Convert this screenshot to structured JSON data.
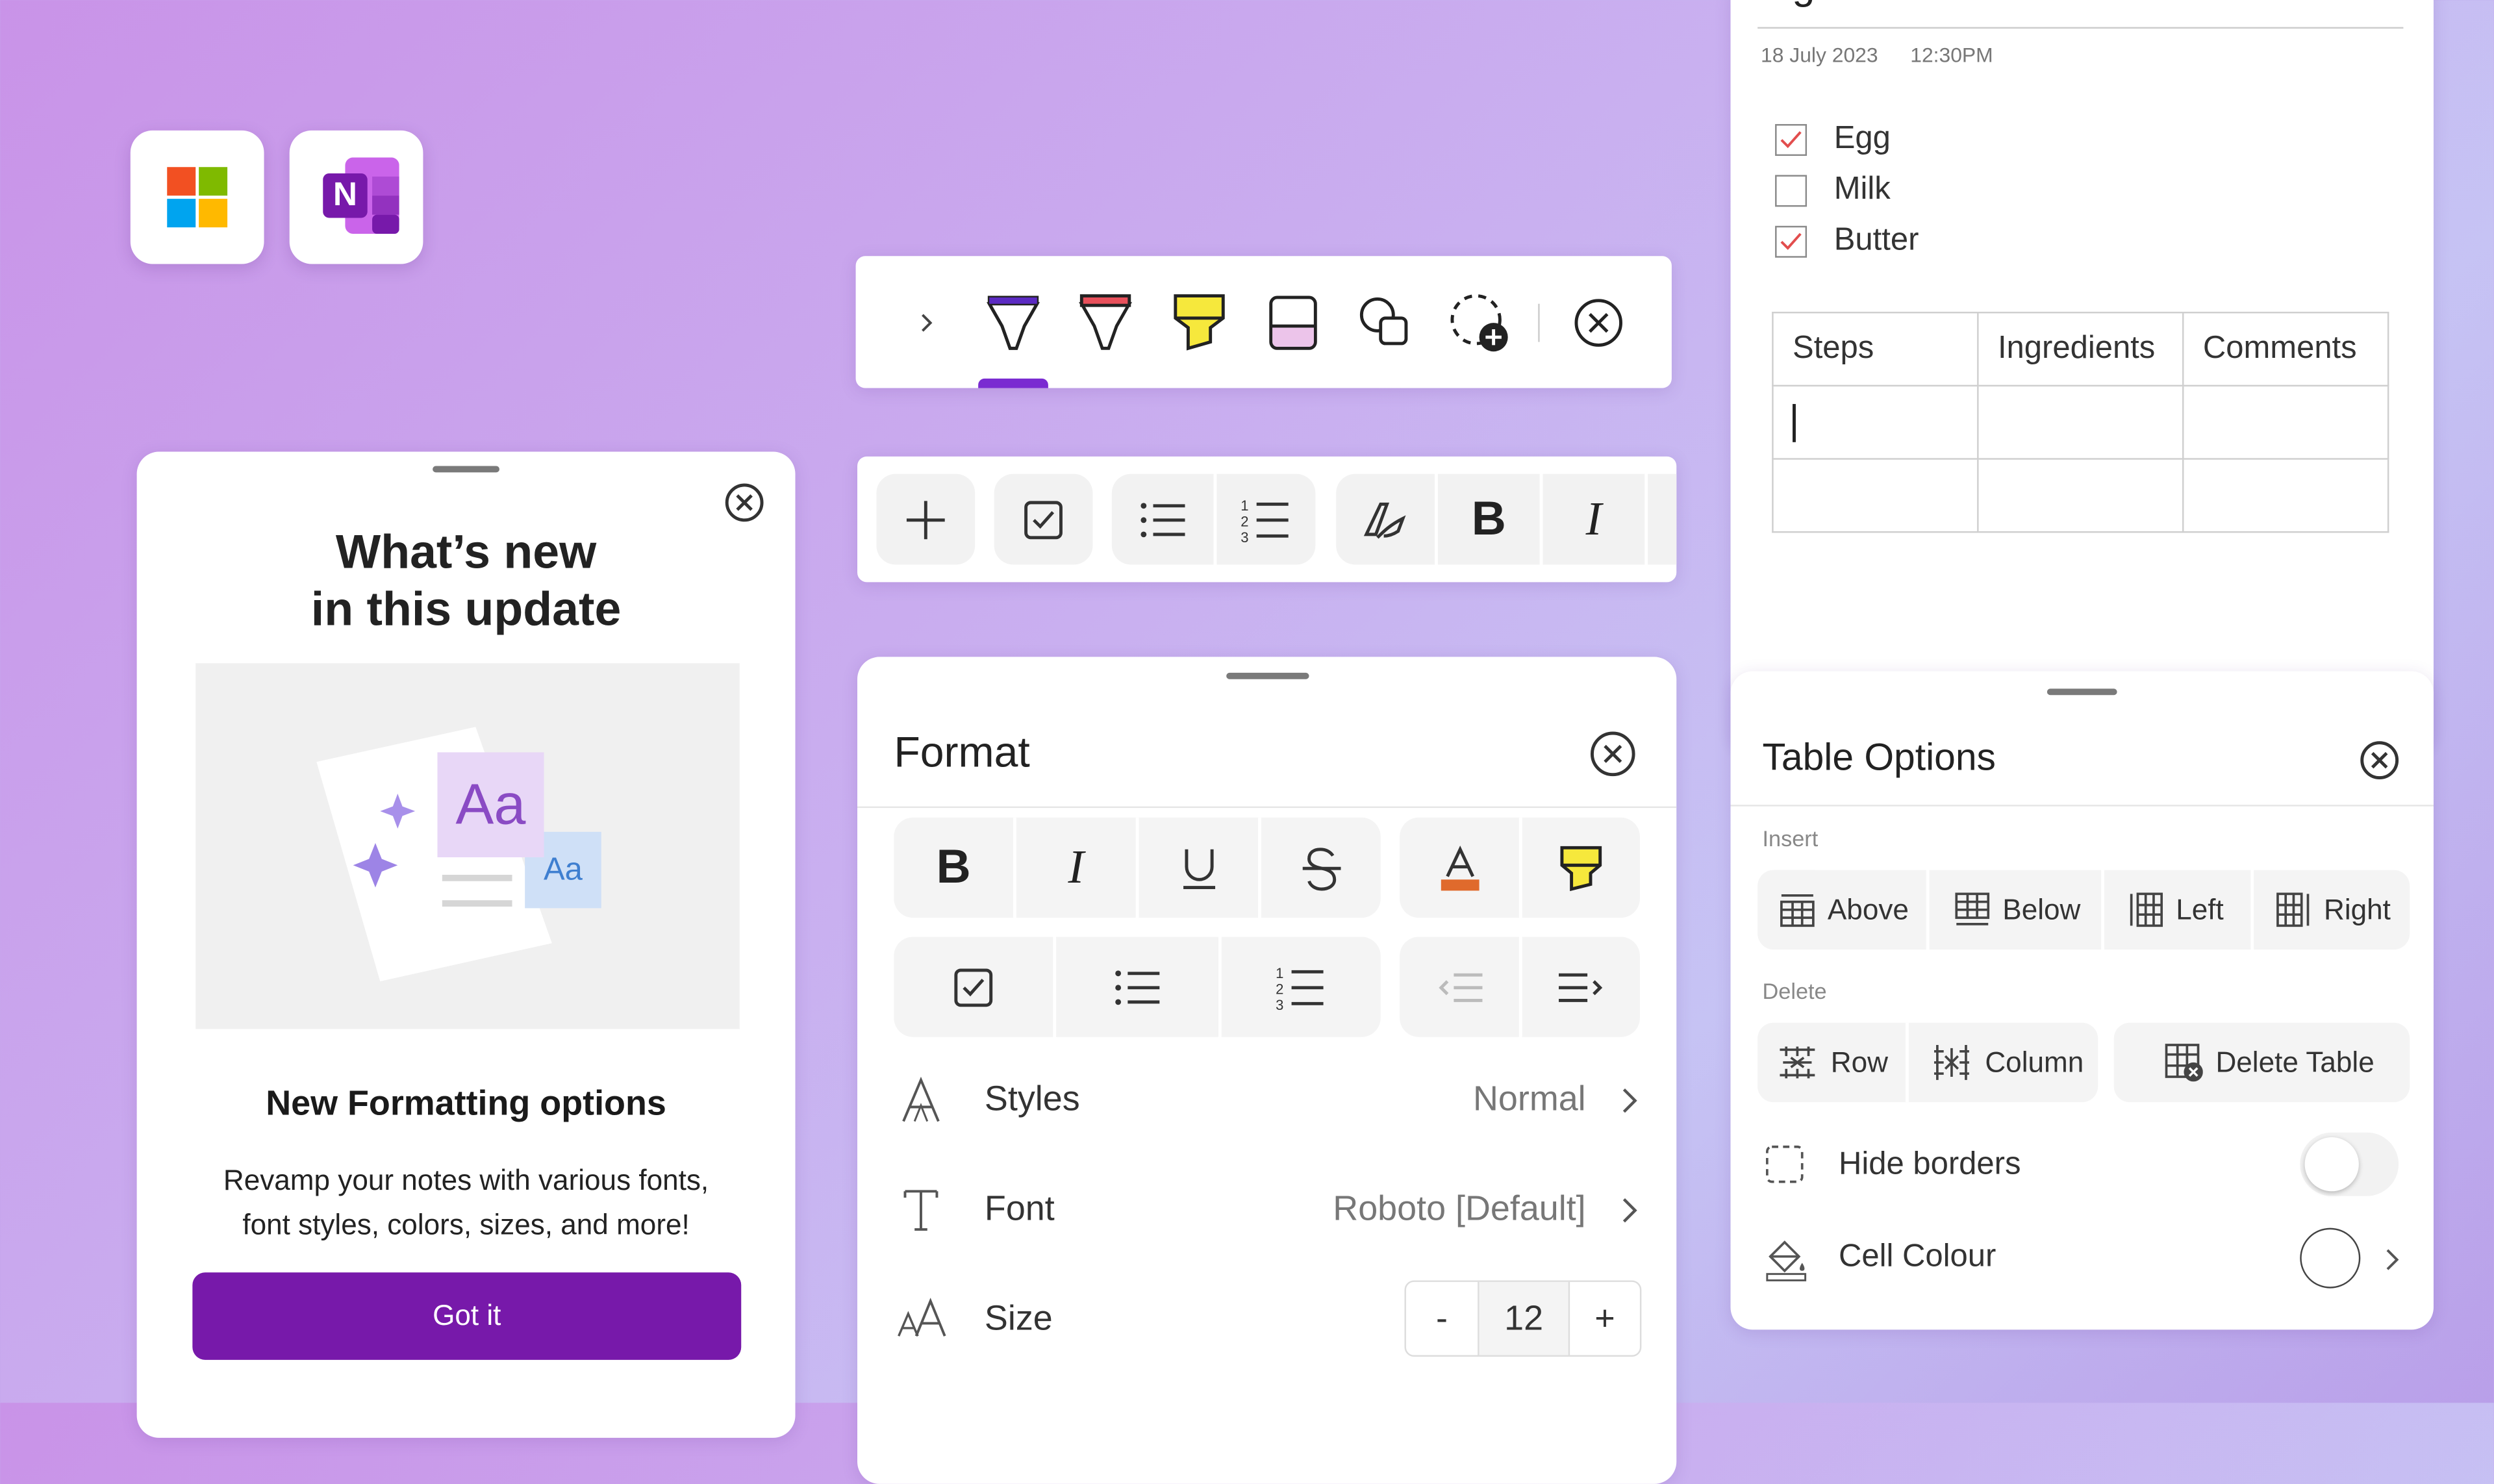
{
  "app_icons": [
    {
      "icon": "microsoft-logo-icon"
    },
    {
      "icon": "onenote-logo-icon",
      "letter": "N"
    }
  ],
  "whats_new": {
    "title_line1": "What’s new",
    "title_line2": "in this update",
    "illustration_big": "Aa",
    "illustration_small": "Aa",
    "subtitle": "New Formatting options",
    "description_line1": "Revamp your notes with various fonts,",
    "description_line2": "font styles, colors, sizes, and more!",
    "button_label": "Got it"
  },
  "pen_toolbar": {
    "tools": [
      "chevron-right-icon",
      "purple-pen-icon",
      "red-pen-icon",
      "yellow-highlighter-icon",
      "eraser-icon",
      "shapes-icon",
      "lasso-add-icon",
      "close-icon"
    ],
    "active_tool": "purple-pen-icon",
    "colors": {
      "purple": "#5b2ac2",
      "red": "#e8505b",
      "yellow": "#f6e83c",
      "active": "#7a2bd1"
    }
  },
  "format_toolbar": {
    "buttons": [
      "add-icon",
      "checkbox-icon",
      "bullet-list-icon",
      "numbered-list-icon",
      "pen-format-icon",
      "bold-icon",
      "italic-icon"
    ],
    "bold_glyph": "B",
    "italic_glyph": "I"
  },
  "format_panel": {
    "title": "Format",
    "row1": [
      "bold-icon",
      "italic-icon",
      "underline-icon",
      "strikethrough-icon",
      "font-color-icon",
      "highlight-icon"
    ],
    "row2": [
      "checkbox-icon",
      "bullet-list-icon",
      "numbered-list-icon",
      "decrease-indent-icon",
      "increase-indent-icon"
    ],
    "styles_label": "Styles",
    "styles_value": "Normal",
    "font_label": "Font",
    "font_value": "Roboto [Default]",
    "size_label": "Size",
    "size_value": "12",
    "size_minus": "-",
    "size_plus": "+"
  },
  "note": {
    "title": "Ingredients",
    "date": "18 July 2023",
    "time": "12:30PM",
    "checklist": [
      {
        "label": "Egg",
        "checked": true
      },
      {
        "label": "Milk",
        "checked": false
      },
      {
        "label": "Butter",
        "checked": true
      }
    ],
    "table_headers": [
      "Steps",
      "Ingredients",
      "Comments"
    ],
    "table_rows": [
      [
        "",
        "",
        ""
      ],
      [
        "",
        "",
        ""
      ]
    ]
  },
  "table_options": {
    "title": "Table Options",
    "insert_label": "Insert",
    "insert_buttons": [
      "Above",
      "Below",
      "Left",
      "Right"
    ],
    "delete_label": "Delete",
    "delete_buttons": [
      "Row",
      "Column",
      "Delete Table"
    ],
    "hide_borders_label": "Hide borders",
    "hide_borders_on": false,
    "cell_colour_label": "Cell Colour",
    "cell_colour_value": "#ffffff"
  }
}
